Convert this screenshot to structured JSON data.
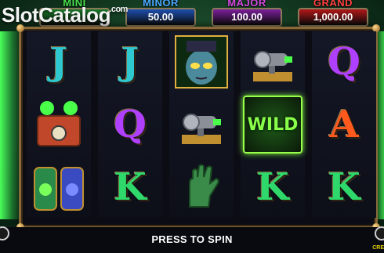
{
  "logo": {
    "text": "SlotCatalog",
    "suffix": ".com"
  },
  "jackpots": [
    {
      "name": "MINI",
      "value": "",
      "name_color": "#48e04a",
      "box_color": "#1a7a2a"
    },
    {
      "name": "MINOR",
      "value": "50.00",
      "name_color": "#4aa8ff",
      "box_color": "#1d4fb0"
    },
    {
      "name": "MAJOR",
      "value": "100.00",
      "name_color": "#d44ae0",
      "box_color": "#7b1f9a"
    },
    {
      "name": "GRAND",
      "value": "1,000.00",
      "name_color": "#ff4040",
      "box_color": "#b01818"
    }
  ],
  "reels": [
    [
      "letter:J",
      "",
      "capsule"
    ],
    [
      "letter:J",
      "letter:Q",
      "letter:K"
    ],
    [
      "monster",
      "cannon",
      "hand"
    ],
    [
      "cannon",
      "wild:WILD",
      "letter:K"
    ],
    [
      "letter:Q",
      "letter:A",
      "letter:K"
    ]
  ],
  "symbol_colors": {
    "J": "#2fc8d0",
    "Q": "#b040ff",
    "K": "#2ed86a",
    "A": "#ff5a1e"
  },
  "spin_label": "PRESS TO SPIN",
  "credit_label": "CRE"
}
